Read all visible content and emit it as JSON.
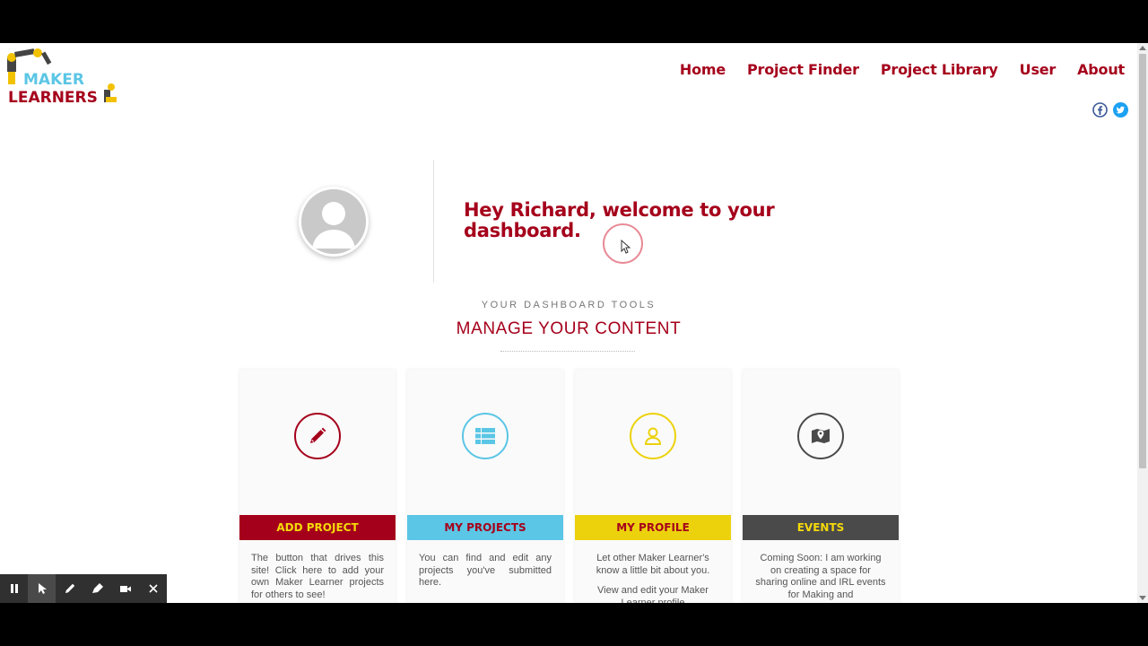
{
  "logo": {
    "line1": "MAKER",
    "line2": "LEARNERS"
  },
  "nav": {
    "items": [
      {
        "label": "Home"
      },
      {
        "label": "Project Finder"
      },
      {
        "label": "Project Library"
      },
      {
        "label": "User"
      },
      {
        "label": "About"
      }
    ]
  },
  "social": {
    "icons": [
      "facebook-icon",
      "twitter-icon"
    ]
  },
  "welcome": {
    "line1": "Hey Richard, welcome to your",
    "line2": "dashboard."
  },
  "section": {
    "subtitle": "YOUR DASHBOARD TOOLS",
    "title": "MANAGE YOUR CONTENT"
  },
  "cards": [
    {
      "icon": "pencil-icon",
      "title": "ADD PROJECT",
      "color": "#a5001b",
      "text_color": "#f5d90a",
      "desc": [
        "The button that drives this site! Click here to add your own Maker Learner projects for others to see!"
      ]
    },
    {
      "icon": "table-icon",
      "title": "MY PROJECTS",
      "color": "#5bc6e5",
      "text_color": "#a5001b",
      "desc": [
        "You can find and edit any projects you've submitted here."
      ]
    },
    {
      "icon": "user-icon",
      "title": "MY PROFILE",
      "color": "#ecd20d",
      "text_color": "#a5001b",
      "desc": [
        "Let other Maker Learner's know a little bit about you.",
        "View and edit your Maker Learner profile"
      ]
    },
    {
      "icon": "map-icon",
      "title": "EVENTS",
      "color": "#4a4a4a",
      "text_color": "#f5d90a",
      "desc": [
        "Coming Soon: I am working on creating a space for sharing online and IRL events for Making and"
      ]
    }
  ],
  "colors": {
    "brand_red": "#a5001b",
    "brand_blue": "#5bc6e5",
    "brand_yellow": "#ecd20d"
  },
  "recorder": {
    "tools": [
      "pause-icon",
      "pointer-icon",
      "pen-icon",
      "highlighter-icon",
      "camera-icon",
      "close-icon"
    ]
  }
}
